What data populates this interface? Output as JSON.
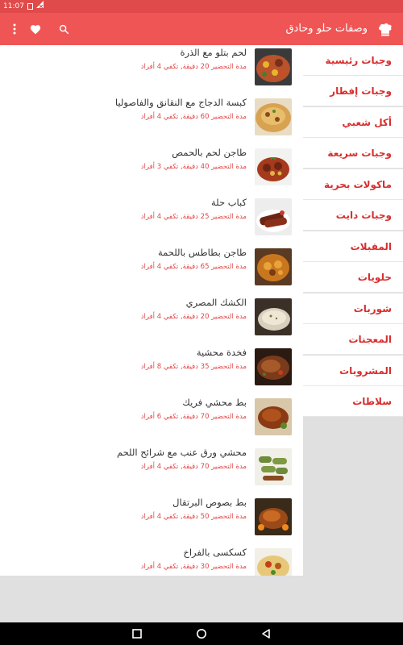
{
  "status": {
    "time": "11:07"
  },
  "app": {
    "title": "وصفات حلو وحادق"
  },
  "theme": {
    "accent": "#f05555",
    "status_bar": "#e14a4a",
    "category_text": "#d92d2d",
    "meta_text": "#e04848"
  },
  "icons": {
    "logo": "chef-hat-icon",
    "search": "search-icon",
    "favorites": "heart-icon",
    "menu": "more-vertical-icon"
  },
  "categories": [
    "وجبات رئيسية",
    "وجبات إفطار",
    "أكل شعبي",
    "وجبات سريعة",
    "ماكولات بحرية",
    "وجبات دايت",
    "المقبلات",
    "حلويات",
    "شوربات",
    "المعجنات",
    "المشروبات",
    "سلاطات"
  ],
  "recipes": [
    {
      "title": "لحم بتلو مع الذرة",
      "meta": "مدة التحضير 20 دقيقة, تكفي 4 أفراد",
      "image": "meat-corn"
    },
    {
      "title": "كبسة الدجاج مع النقانق والفاصوليا",
      "meta": "مدة التحضير 60 دقيقة, تكفي 4 أفراد",
      "image": "rice"
    },
    {
      "title": "طاجن لحم بالحمص",
      "meta": "مدة التحضير 40 دقيقة, تكفي 3 أفراد",
      "image": "stew"
    },
    {
      "title": "كباب حلة",
      "meta": "مدة التحضير 25 دقيقة, تكفي 4 أفراد",
      "image": "kebab"
    },
    {
      "title": "طاجن بطاطس باللحمة",
      "meta": "مدة التحضير 65 دقيقة, تكفي 4 أفراد",
      "image": "potato-stew"
    },
    {
      "title": "الكشك المصري",
      "meta": "مدة التحضير 20 دقيقة, تكفي 4 أفراد",
      "image": "soup"
    },
    {
      "title": "فخدة محشية",
      "meta": "مدة التحضير 35 دقيقة, تكفي 8 أفراد",
      "image": "roast"
    },
    {
      "title": "بط محشي فريك",
      "meta": "مدة التحضير 70 دقيقة, تكفي 6 أفراد",
      "image": "duck"
    },
    {
      "title": "محشي ورق عنب مع شرائح اللحم",
      "meta": "مدة التحضير 70 دقيقة, تكفي 4 أفراد",
      "image": "grape-leaves"
    },
    {
      "title": "بط بصوص البرتقال",
      "meta": "مدة التحضير 50 دقيقة, تكفي 4 أفراد",
      "image": "orange-duck"
    },
    {
      "title": "كسكسى بالفراخ",
      "meta": "مدة التحضير 30 دقيقة, تكفي 4 أفراد",
      "image": "couscous"
    }
  ]
}
